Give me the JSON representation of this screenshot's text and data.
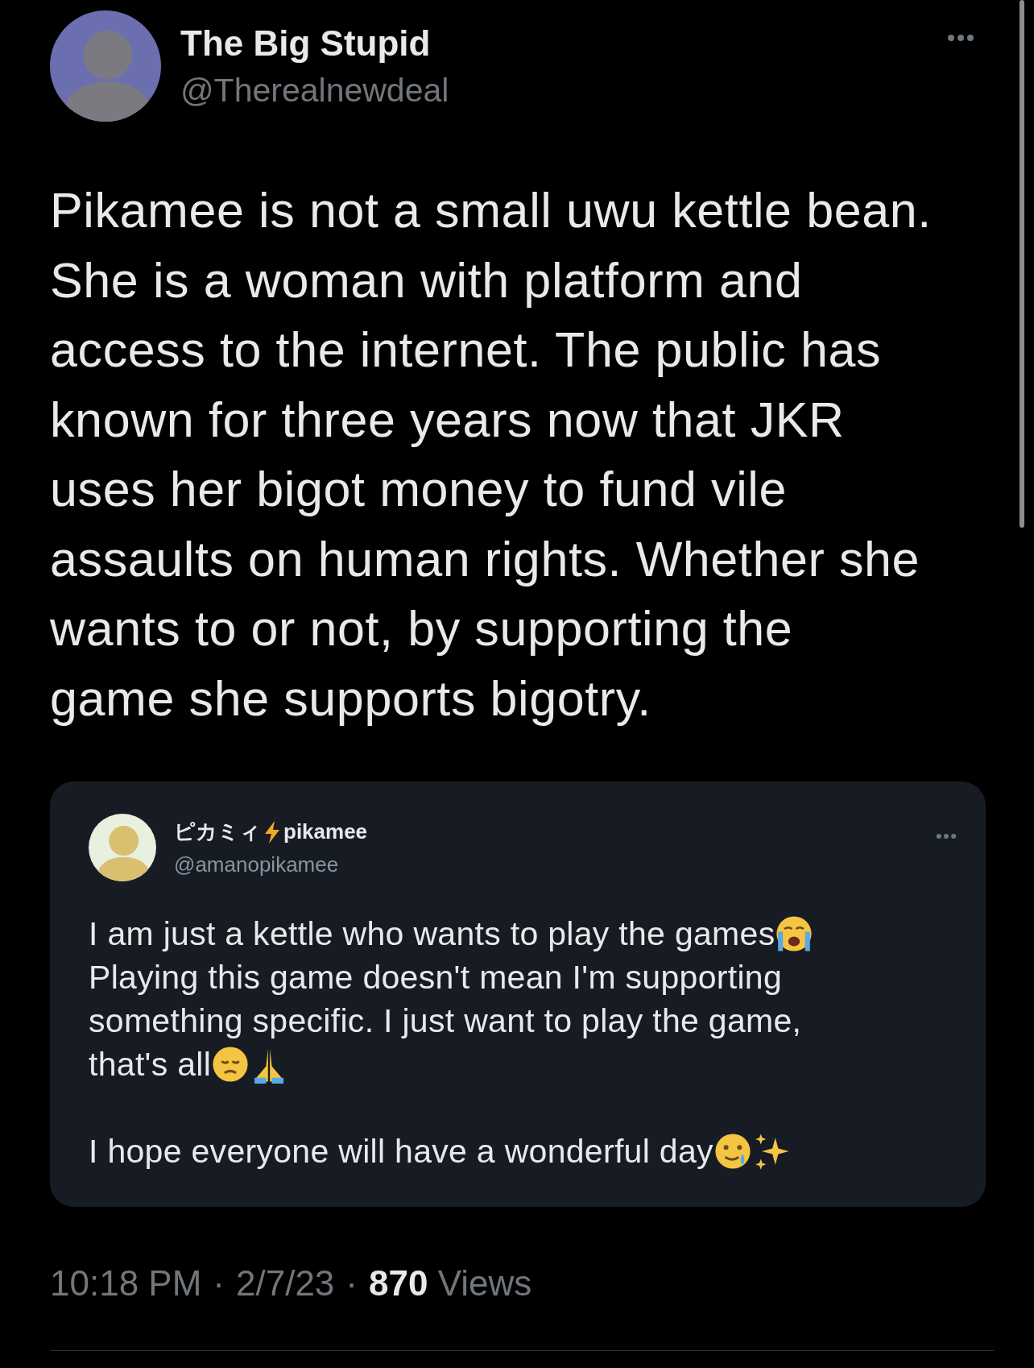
{
  "tweet": {
    "name": "The Big Stupid",
    "handle": "@Therealnewdeal",
    "text": "Pikamee is not a small uwu kettle bean.\nShe is a woman with platform and\naccess to the internet. The public has\nknown for three years now that JKR\nuses her bigot money to fund vile\nassaults on human rights. Whether she\nwants to or not, by supporting the\ngame she supports bigotry.",
    "quote": {
      "name": [
        "ピカミィ",
        "pikamee"
      ],
      "handle": "@amanopikamee",
      "lines": [
        [
          {
            "kind": "text",
            "text": "I am just a kettle who wants to play the games"
          },
          {
            "kind": "emoji"
          }
        ],
        [
          {
            "kind": "text",
            "text": "Playing this game doesn't mean I'm supporting"
          }
        ],
        [
          {
            "kind": "text",
            "text": "something specific. I just want to play the game,"
          }
        ],
        [
          {
            "kind": "text",
            "text": "that's all"
          },
          {
            "kind": "emoji"
          },
          {
            "kind": "emoji"
          }
        ],
        [
          {
            "kind": "blank"
          }
        ],
        [
          {
            "kind": "text",
            "text": "I hope everyone will have a wonderful day"
          },
          {
            "kind": "emoji"
          },
          {
            "kind": "emoji"
          }
        ]
      ]
    },
    "time": "10:18 PM",
    "separators": [
      "·",
      "·"
    ],
    "date": "2/7/23",
    "views_count": "870",
    "views_label": "Views"
  }
}
